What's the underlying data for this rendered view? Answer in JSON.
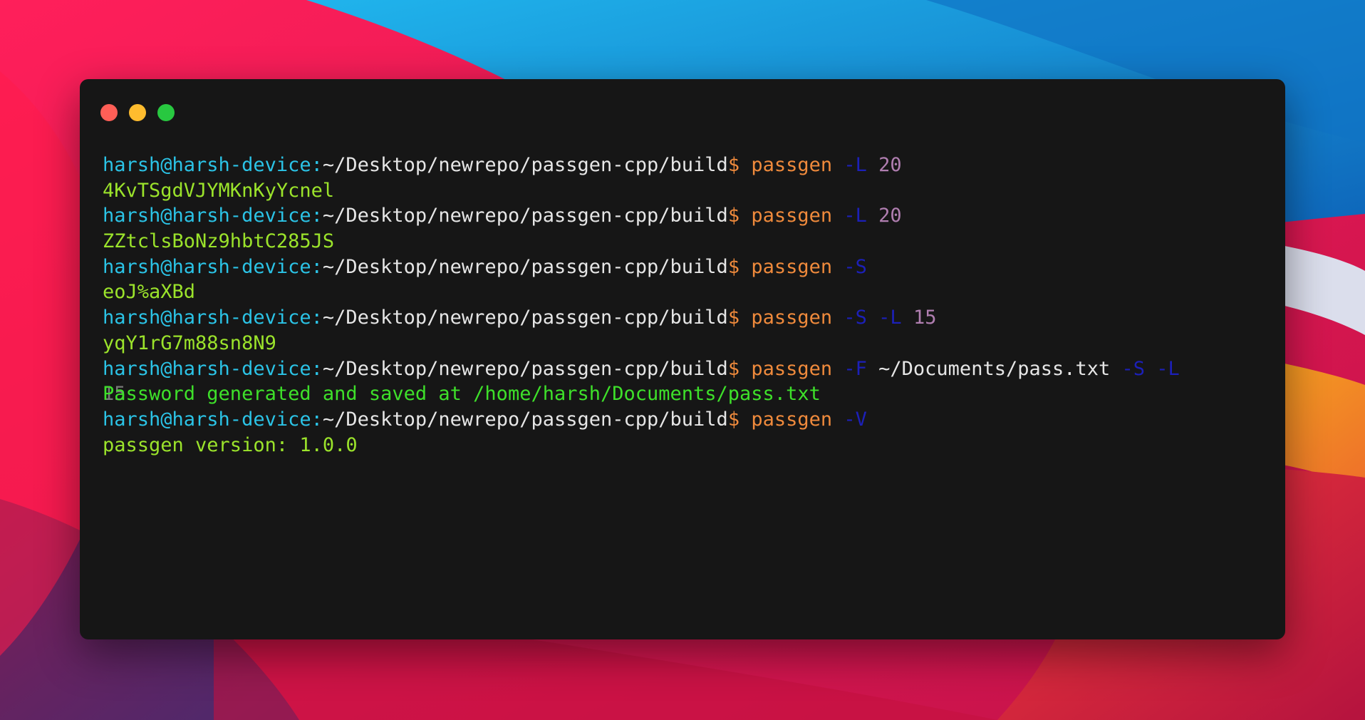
{
  "terminal": {
    "lines": [
      {
        "user": "harsh@harsh-device:",
        "path": "~/Desktop/newrepo/passgen-cpp/build",
        "dollar": "$ ",
        "cmd": "passgen ",
        "tokens": [
          {
            "t": "-L",
            "k": "flag"
          },
          {
            "t": " ",
            "k": "arg"
          },
          {
            "t": "20",
            "k": "num"
          }
        ]
      },
      {
        "output": "4KvTSgdVJYMKnKyYcnel"
      },
      {
        "user": "harsh@harsh-device:",
        "path": "~/Desktop/newrepo/passgen-cpp/build",
        "dollar": "$ ",
        "cmd": "passgen ",
        "tokens": [
          {
            "t": "-L",
            "k": "flag"
          },
          {
            "t": " ",
            "k": "arg"
          },
          {
            "t": "20",
            "k": "num"
          }
        ]
      },
      {
        "output": "ZZtclsBoNz9hbtC285JS"
      },
      {
        "user": "harsh@harsh-device:",
        "path": "~/Desktop/newrepo/passgen-cpp/build",
        "dollar": "$ ",
        "cmd": "passgen ",
        "tokens": [
          {
            "t": "-S",
            "k": "flag"
          }
        ]
      },
      {
        "output": "eoJ%aXBd"
      },
      {
        "user": "harsh@harsh-device:",
        "path": "~/Desktop/newrepo/passgen-cpp/build",
        "dollar": "$ ",
        "cmd": "passgen ",
        "tokens": [
          {
            "t": "-S",
            "k": "flag"
          },
          {
            "t": " ",
            "k": "arg"
          },
          {
            "t": "-L",
            "k": "flag"
          },
          {
            "t": " ",
            "k": "arg"
          },
          {
            "t": "15",
            "k": "num"
          }
        ]
      },
      {
        "output": "yqY1rG7m88sn8N9"
      },
      {
        "user": "harsh@harsh-device:",
        "path": "~/Desktop/newrepo/passgen-cpp/build",
        "dollar": "$ ",
        "cmd": "passgen ",
        "tokens": [
          {
            "t": "-F",
            "k": "flag"
          },
          {
            "t": " ~/Documents/pass.txt ",
            "k": "arg"
          },
          {
            "t": "-S",
            "k": "flag"
          },
          {
            "t": " ",
            "k": "arg"
          },
          {
            "t": "-L",
            "k": "flag"
          }
        ]
      },
      {
        "output": "Password generated and saved at /home/harsh/Documents/pass.txt",
        "overlay": "15",
        "style": "out2"
      },
      {
        "user": "harsh@harsh-device:",
        "path": "~/Desktop/newrepo/passgen-cpp/build",
        "dollar": "$ ",
        "cmd": "passgen ",
        "tokens": [
          {
            "t": "-V",
            "k": "flag"
          }
        ]
      },
      {
        "output": "passgen version: 1.0.0"
      }
    ]
  },
  "colors": {
    "window_bg": "#161616",
    "user": "#2bc3e6",
    "command": "#ef8a3c",
    "flag": "#1c20b8",
    "number": "#b07eb0",
    "output": "#9be32b"
  }
}
